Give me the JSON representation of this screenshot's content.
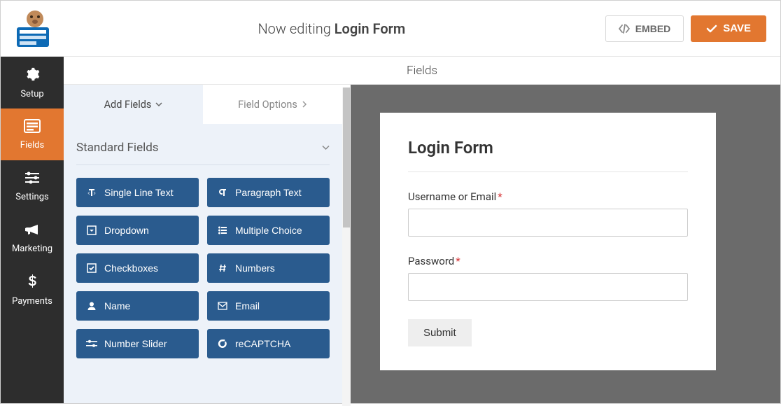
{
  "header": {
    "now_editing": "Now editing",
    "form_name": "Login Form",
    "embed": "EMBED",
    "save": "SAVE"
  },
  "sidebar": {
    "items": [
      {
        "label": "Setup",
        "icon": "gear"
      },
      {
        "label": "Fields",
        "icon": "form"
      },
      {
        "label": "Settings",
        "icon": "sliders"
      },
      {
        "label": "Marketing",
        "icon": "bullhorn"
      },
      {
        "label": "Payments",
        "icon": "dollar"
      }
    ]
  },
  "right_header": "Fields",
  "panel": {
    "tabs": {
      "add_fields": "Add Fields",
      "field_options": "Field Options"
    },
    "section_title": "Standard Fields",
    "fields": [
      {
        "label": "Single Line Text",
        "icon": "text-height"
      },
      {
        "label": "Paragraph Text",
        "icon": "paragraph"
      },
      {
        "label": "Dropdown",
        "icon": "caret-square"
      },
      {
        "label": "Multiple Choice",
        "icon": "list"
      },
      {
        "label": "Checkboxes",
        "icon": "check-square"
      },
      {
        "label": "Numbers",
        "icon": "hash"
      },
      {
        "label": "Name",
        "icon": "user"
      },
      {
        "label": "Email",
        "icon": "envelope"
      },
      {
        "label": "Number Slider",
        "icon": "slider"
      },
      {
        "label": "reCAPTCHA",
        "icon": "google"
      }
    ]
  },
  "preview": {
    "title": "Login Form",
    "fields": [
      {
        "label": "Username or Email",
        "required": true
      },
      {
        "label": "Password",
        "required": true
      }
    ],
    "submit": "Submit"
  }
}
